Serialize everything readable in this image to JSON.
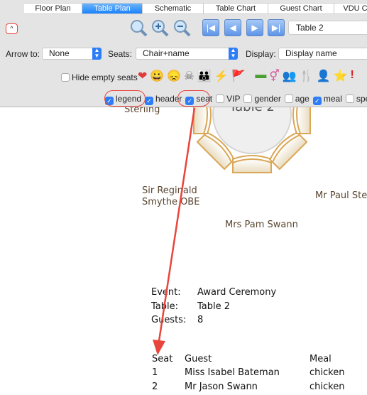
{
  "tabs": [
    "Floor Plan",
    "Table Plan",
    "Schematic",
    "Table Chart",
    "Guest Chart",
    "VDU C"
  ],
  "active_tab": 1,
  "toolbar": {
    "collapse": "^",
    "table_select": "Table 2",
    "arrow_to_label": "Arrow to:",
    "arrow_to_value": "None",
    "seats_label": "Seats:",
    "seats_value": "Chair+name",
    "display_label": "Display:",
    "display_value": "Display name",
    "hide_empty": "Hide empty seats"
  },
  "icon_glyphs": [
    "❤",
    "😀",
    "😞",
    "☠",
    "👪",
    "⚡",
    "🚩",
    "▬",
    "⚥",
    "👥",
    "🍴",
    "👤",
    "⭐",
    "!"
  ],
  "flags": [
    {
      "label": "legend",
      "checked": true
    },
    {
      "label": "header",
      "checked": true
    },
    {
      "label": "seat",
      "checked": true
    },
    {
      "label": "VIP",
      "checked": false
    },
    {
      "label": "gender",
      "checked": false
    },
    {
      "label": "age",
      "checked": false
    },
    {
      "label": "meal",
      "checked": true
    },
    {
      "label": "special",
      "checked": false
    }
  ],
  "plan": {
    "table_name": "Table 2",
    "guests": [
      "Sterling",
      "Sir Reginald\nSmythe OBE",
      "Mrs Pam Swann",
      "Mr Paul Ste"
    ]
  },
  "legend": {
    "event_label": "Event:",
    "event": "Award Ceremony",
    "table_label": "Table:",
    "table": "Table 2",
    "guests_label": "Guests:",
    "guests": "8",
    "headers": [
      "Seat",
      "Guest",
      "Meal"
    ],
    "rows": [
      [
        "1",
        "Miss Isabel Bateman",
        "chicken"
      ],
      [
        "2",
        "Mr Jason Swann",
        "chicken"
      ]
    ]
  },
  "colors": {
    "accent": "#2d7ef6",
    "annotation": "#e8453c",
    "chair": "#d9a757"
  }
}
